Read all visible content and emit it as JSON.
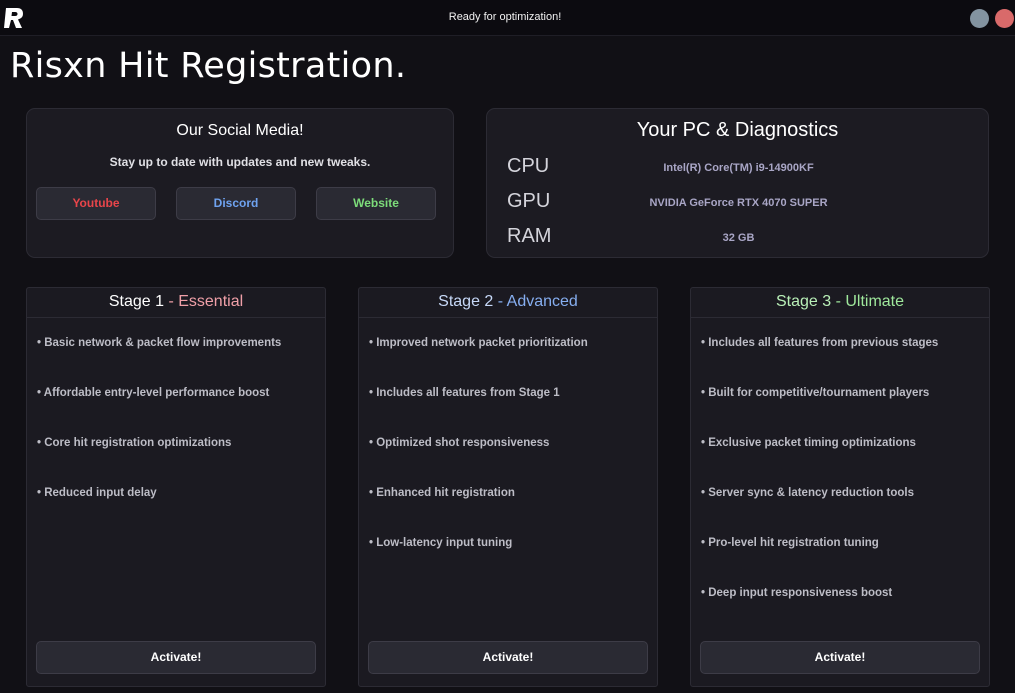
{
  "window": {
    "status": "Ready for optimization!",
    "logo_text": "R"
  },
  "app_title": "Risxn Hit Registration.",
  "social": {
    "title": "Our Social Media!",
    "subtitle": "Stay up to date with updates and new tweaks.",
    "buttons": [
      {
        "label": "Youtube",
        "color": "#e8454a"
      },
      {
        "label": "Discord",
        "color": "#6fa3f0"
      },
      {
        "label": "Website",
        "color": "#7ddc7a"
      }
    ]
  },
  "diagnostics": {
    "title": "Your PC & Diagnostics",
    "rows": [
      {
        "key": "CPU",
        "value": "Intel(R) Core(TM) i9-14900KF"
      },
      {
        "key": "GPU",
        "value": "NVIDIA GeForce RTX 4070 SUPER"
      },
      {
        "key": "RAM",
        "value": "32 GB"
      }
    ]
  },
  "stages": [
    {
      "name": "Stage 1",
      "separator": " - ",
      "tier": "Essential",
      "features": [
        "• Basic network & packet flow improvements",
        "• Affordable entry-level performance boost",
        "• Core hit registration optimizations",
        "• Reduced input delay"
      ],
      "button": "Activate!"
    },
    {
      "name": "Stage 2",
      "separator": " - ",
      "tier": "Advanced",
      "features": [
        "• Improved network packet prioritization",
        "• Includes all features from Stage 1",
        "• Optimized shot responsiveness",
        "• Enhanced hit registration",
        "• Low-latency input tuning"
      ],
      "button": "Activate!"
    },
    {
      "name": "Stage 3",
      "separator": " - ",
      "tier": "Ultimate",
      "features": [
        "• Includes all features from previous stages",
        "• Built for competitive/tournament players",
        "• Exclusive packet timing optimizations",
        "• Server sync & latency reduction tools",
        "• Pro-level hit registration tuning",
        "• Deep input responsiveness boost"
      ],
      "button": "Activate!"
    }
  ]
}
